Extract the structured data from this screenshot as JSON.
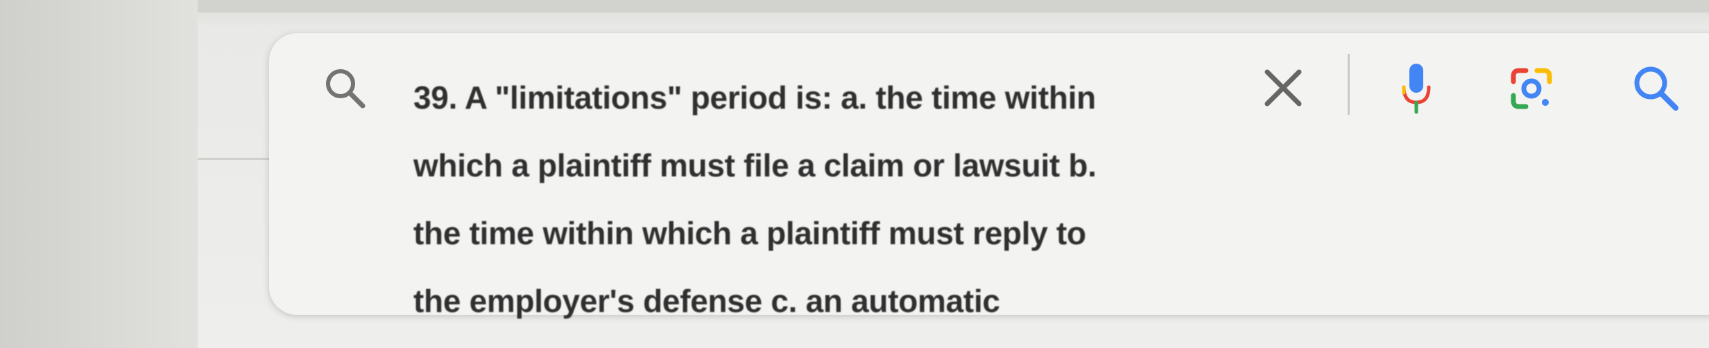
{
  "search": {
    "query_lines": [
      "39. A \"limitations\" period is: a. the time within",
      "which a plaintiff must file a claim or lawsuit b.",
      "the time within which a plaintiff must reply to",
      "the employer's defense c. an automatic"
    ],
    "leading_icon": "search-icon",
    "clear_icon": "close-icon",
    "voice_icon": "microphone-icon",
    "image_search_icon": "google-lens-icon",
    "submit_icon": "search-icon"
  },
  "colors": {
    "text": "#2f2f2f",
    "icon_gray": "#6f6f6f",
    "google_blue": "#4285f4",
    "google_red": "#ea4335",
    "google_yellow": "#fbbc04",
    "google_green": "#34a853"
  }
}
